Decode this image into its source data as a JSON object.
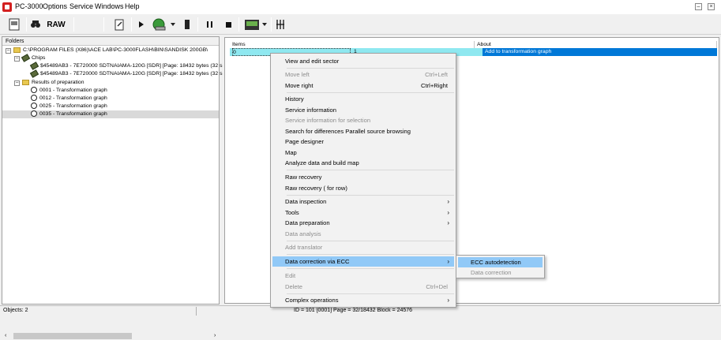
{
  "app": {
    "title": "PC-3000"
  },
  "menubar": [
    "Options",
    "Service",
    "Windows",
    "Help"
  ],
  "toolbar": {
    "raw_label": "RAW"
  },
  "folders": {
    "header": "Folders",
    "root": "C:\\PROGRAM FILES (X86)\\ACE LAB\\PC-3000FLASH\\BIN\\SANDISK 200GB\\",
    "chips_label": "Chips",
    "chips": [
      "$45489AB3 -  7E720000 SDTNAIAMA-120G [SDR] [Page: 18432 bytes (32 s",
      "$45489AB3 -  7E720000 SDTNAIAMA-120G [SDR] [Page: 18432 bytes (32 s"
    ],
    "results_label": "Results of preparation",
    "results": [
      "0001 - Transformation graph",
      "0012 - Transformation graph",
      "0025 - Transformation graph",
      "0035 - Transformation graph"
    ]
  },
  "table": {
    "columns": [
      "Items",
      "About"
    ],
    "row": {
      "c0": "0",
      "c1": "1",
      "about": "Add to transformation graph"
    }
  },
  "context_menu": {
    "items": [
      {
        "label": "View and edit sector",
        "enabled": true
      },
      {
        "label": "Move left",
        "shortcut": "Ctrl+Left",
        "enabled": false
      },
      {
        "label": "Move right",
        "shortcut": "Ctrl+Right",
        "enabled": true
      },
      {
        "label": "History",
        "enabled": true
      },
      {
        "label": "Service information",
        "enabled": true
      },
      {
        "label": "Service information for selection",
        "enabled": false
      },
      {
        "label": "Search for differences Parallel source browsing",
        "enabled": true
      },
      {
        "label": "Page designer",
        "enabled": true
      },
      {
        "label": "Map",
        "enabled": true
      },
      {
        "label": "Analyze data and build map",
        "enabled": true
      },
      {
        "label": "Raw recovery",
        "enabled": true
      },
      {
        "label": "Raw recovery ( for row)",
        "enabled": true
      },
      {
        "label": "Data inspection",
        "enabled": true
      },
      {
        "label": "Tools",
        "enabled": true
      },
      {
        "label": "Data preparation",
        "enabled": true
      },
      {
        "label": "Data analysis",
        "enabled": false
      },
      {
        "label": "Add translator",
        "enabled": false
      },
      {
        "label": "Data correction via ECC",
        "enabled": true
      },
      {
        "label": "Edit",
        "enabled": false
      },
      {
        "label": "Delete",
        "shortcut": "Ctrl+Del",
        "enabled": false
      },
      {
        "label": "Complex operations",
        "enabled": true
      }
    ]
  },
  "submenu": {
    "items": [
      {
        "label": "ECC autodetection",
        "enabled": true
      },
      {
        "label": "Data correction",
        "enabled": false
      }
    ]
  },
  "status": {
    "objects": "Objects: 2",
    "info": "ID = 101 [0001] Page  = 32/18432 Block = 24576"
  },
  "colors": {
    "selection": "#0078d7",
    "row_highlight": "#8fe8f0",
    "menu_highlight": "#91c9f7"
  }
}
